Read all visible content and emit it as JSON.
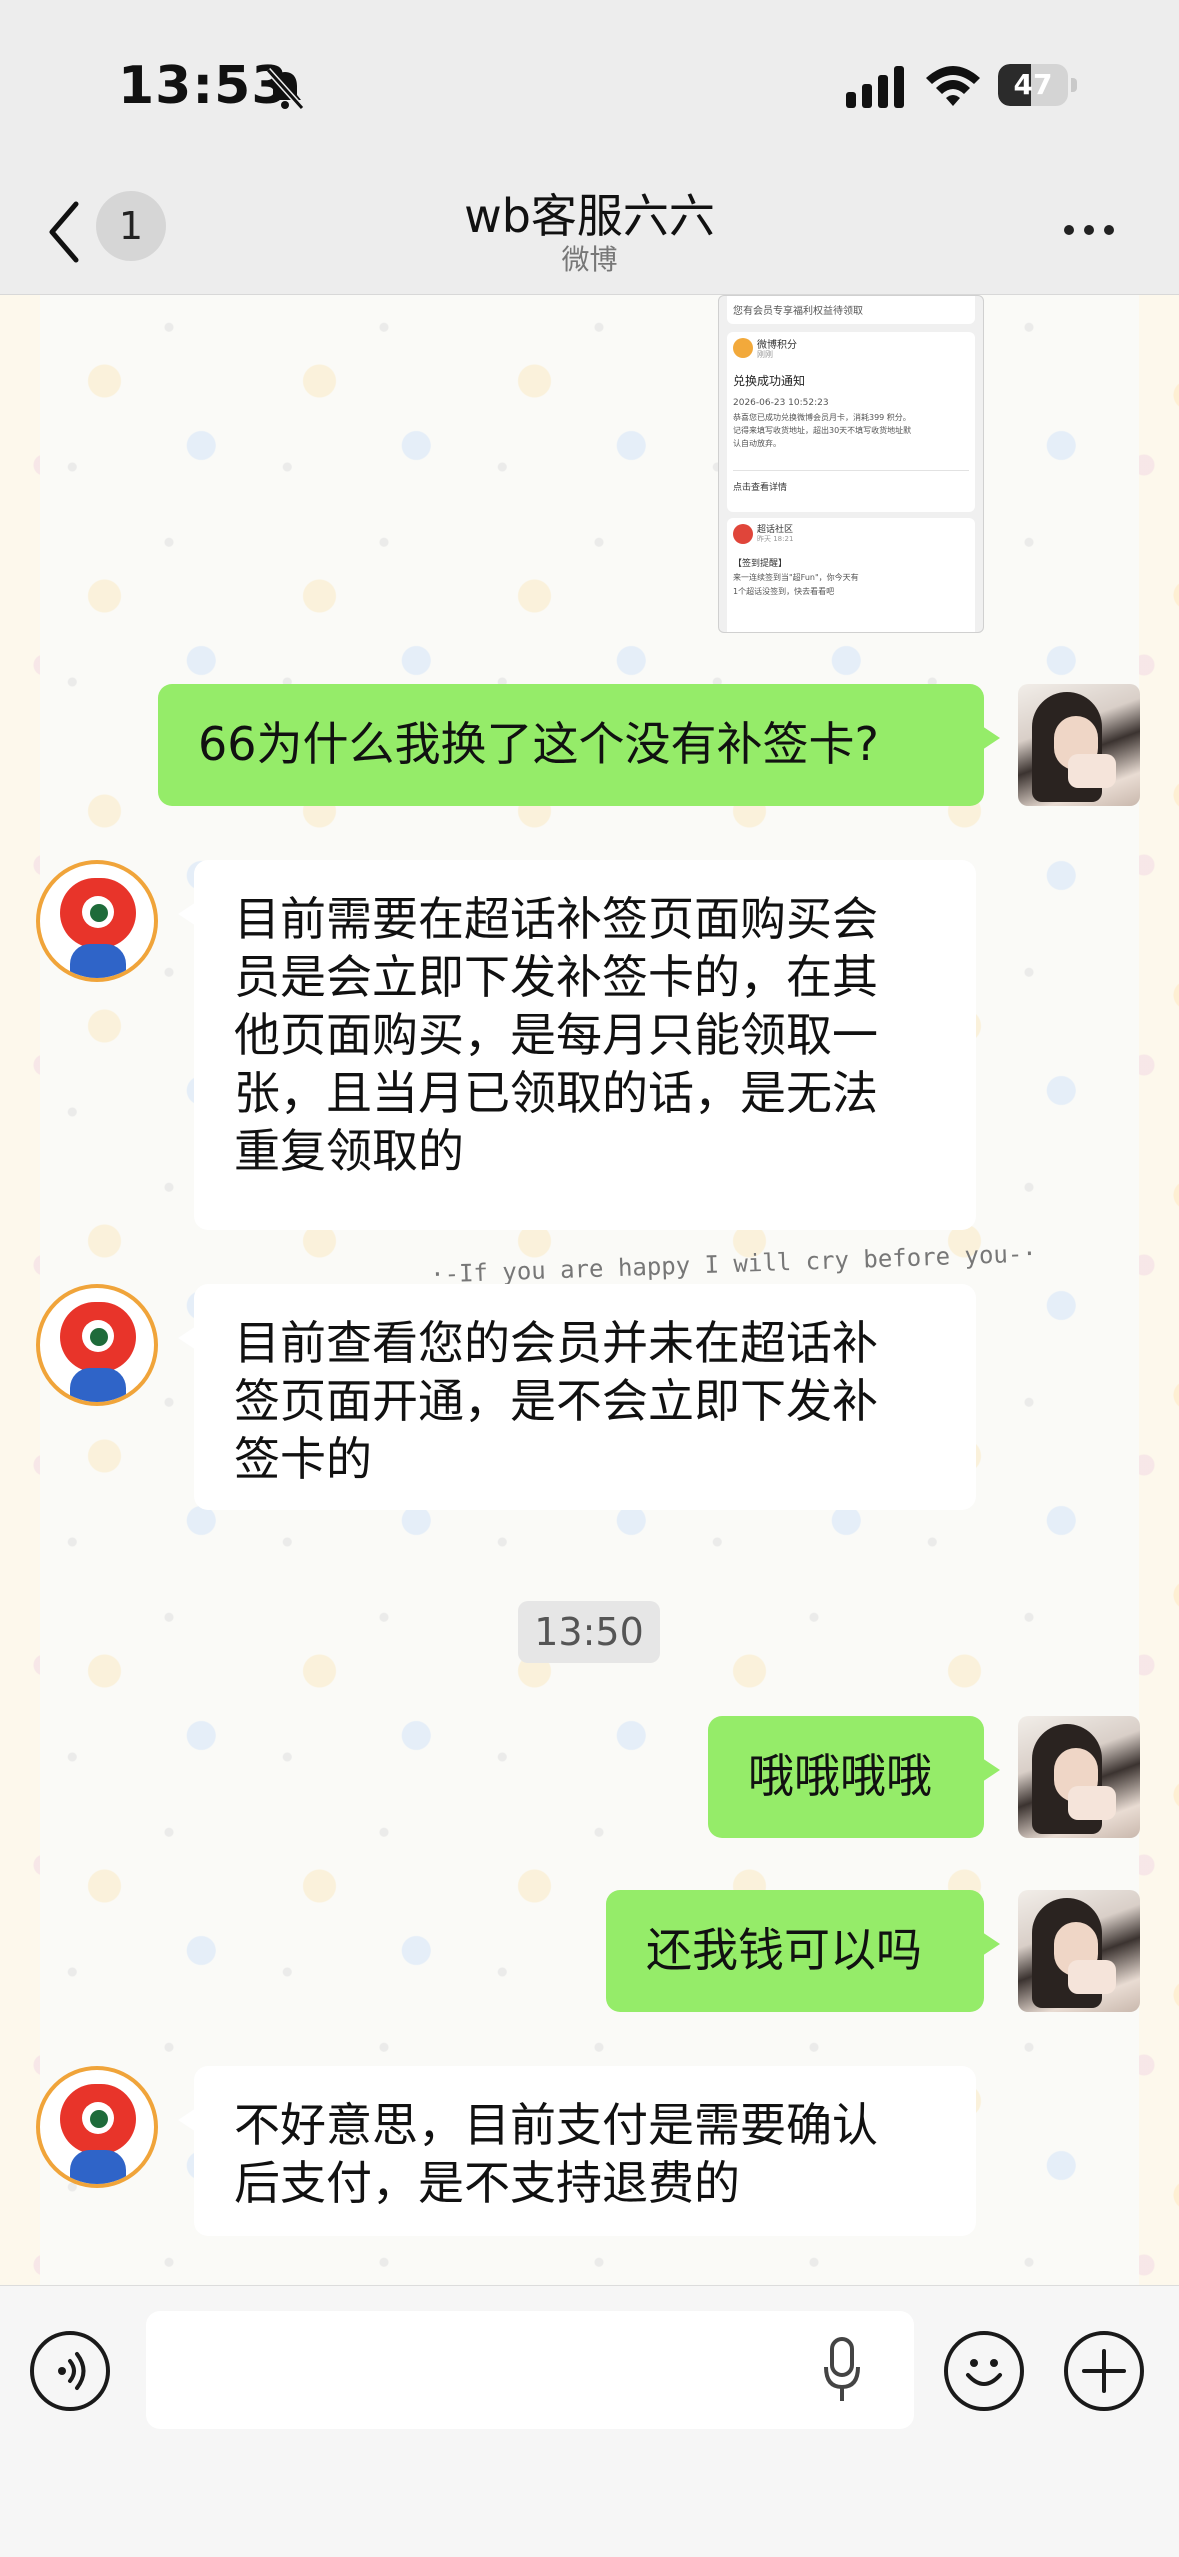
{
  "status_bar": {
    "time": "13:53",
    "battery": "47",
    "battery_level": 0.47
  },
  "header": {
    "unread_count": "1",
    "title": "wb客服六六",
    "subtitle": "微博"
  },
  "messages": [
    {
      "from": "me",
      "text": "66为什么我换了这个没有补签卡?"
    },
    {
      "from": "bot",
      "lines": [
        "目前需要在超话补签页面购买会",
        "员是会立即下发补签卡的，在其",
        "他页面购买，是每月只能领取一",
        "张，且当月已领取的话，是无法",
        "重复领取的"
      ]
    },
    {
      "from": "bot",
      "lines": [
        "目前查看您的会员并未在超话补",
        "签页面开通，是不会立即下发补",
        "签卡的"
      ]
    },
    {
      "from": "me",
      "text": "哦哦哦哦"
    },
    {
      "from": "me",
      "text": "还我钱可以吗"
    },
    {
      "from": "bot",
      "lines": [
        "不好意思，目前支付是需要确认",
        "后支付，是不支持退费的"
      ]
    }
  ],
  "timestamp": "13:50",
  "wallpaper_text": "·-If you are happy I will cry before you-·",
  "shared_screenshot": {
    "row1": "您有会员专享福利权益待领取",
    "app_name": "微博积分",
    "sub": "刚刚",
    "notice_title": "兑换成功通知",
    "notice_date": "2026-06-23 10:52:23",
    "notice_body1": "恭喜您已成功兑换微博会员月卡，消耗399 积分。",
    "notice_body2": "记得来填写收货地址，超出30天不填写收货地址默",
    "notice_body3": "认自动放弃。",
    "view_details": "点击查看详情",
    "community": "超话社区",
    "community_sub": "昨天 18:21",
    "signin_title": "【签到提醒】",
    "signin_body": "来一连续签到当\"超Fun\"，你今天有",
    "signin_body2": "1个超话没签到，快去看看吧"
  },
  "colors": {
    "bubble_me": "#95ec69",
    "bubble_bot": "#ffffff",
    "header_bg": "#ededed"
  },
  "icons": {
    "voice": "voice-icon",
    "emoji": "emoji-icon",
    "plus": "plus-icon",
    "mic": "microphone-icon",
    "back": "chevron-left-icon",
    "more": "more-icon",
    "bell_muted": "bell-muted-icon"
  }
}
